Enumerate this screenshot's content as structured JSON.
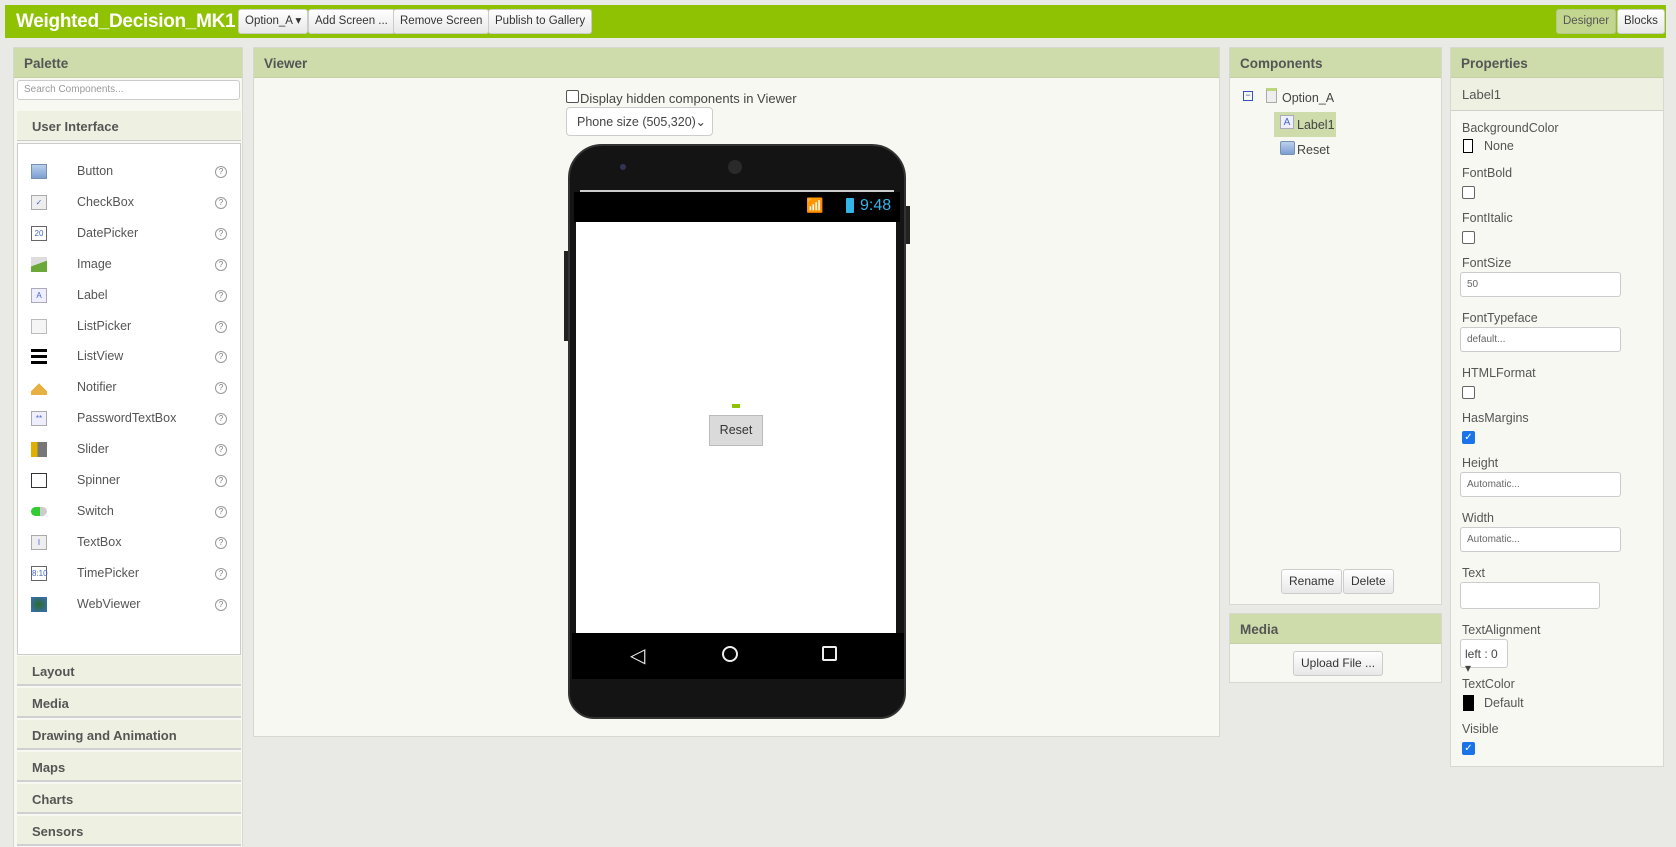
{
  "app": {
    "title": "Weighted_Decision_MK1",
    "screen_selector": "Option_A ▾",
    "add_screen": "Add Screen ...",
    "remove_screen": "Remove Screen",
    "publish": "Publish to Gallery",
    "designer": "Designer",
    "blocks": "Blocks",
    "accent": "#8fc202"
  },
  "palette": {
    "title": "Palette",
    "search_placeholder": "Search Components...",
    "open_category": "User Interface",
    "items": [
      {
        "label": "Button",
        "icon": "button-icon"
      },
      {
        "label": "CheckBox",
        "icon": "checkbox-icon"
      },
      {
        "label": "DatePicker",
        "icon": "datepicker-icon"
      },
      {
        "label": "Image",
        "icon": "image-icon"
      },
      {
        "label": "Label",
        "icon": "label-icon"
      },
      {
        "label": "ListPicker",
        "icon": "listpicker-icon"
      },
      {
        "label": "ListView",
        "icon": "listview-icon"
      },
      {
        "label": "Notifier",
        "icon": "notifier-icon"
      },
      {
        "label": "PasswordTextBox",
        "icon": "password-icon"
      },
      {
        "label": "Slider",
        "icon": "slider-icon"
      },
      {
        "label": "Spinner",
        "icon": "spinner-icon"
      },
      {
        "label": "Switch",
        "icon": "switch-icon"
      },
      {
        "label": "TextBox",
        "icon": "textbox-icon"
      },
      {
        "label": "TimePicker",
        "icon": "timepicker-icon"
      },
      {
        "label": "WebViewer",
        "icon": "webviewer-icon"
      }
    ],
    "help": "?",
    "categories": [
      "Layout",
      "Media",
      "Drawing and Animation",
      "Maps",
      "Charts",
      "Sensors"
    ]
  },
  "viewer": {
    "title": "Viewer",
    "hidden_label": "Display hidden components in Viewer",
    "size_select": "Phone size (505,320)",
    "clock": "9:48",
    "reset_button": "Reset"
  },
  "components": {
    "title": "Components",
    "tree": [
      {
        "label": "Option_A"
      },
      {
        "label": "Label1",
        "selected": true
      },
      {
        "label": "Reset"
      }
    ],
    "rename": "Rename",
    "delete": "Delete"
  },
  "media": {
    "title": "Media",
    "upload": "Upload File ..."
  },
  "properties": {
    "title": "Properties",
    "component": "Label1",
    "BackgroundColor": {
      "label": "BackgroundColor",
      "value": "None"
    },
    "FontBold": {
      "label": "FontBold",
      "checked": false
    },
    "FontItalic": {
      "label": "FontItalic",
      "checked": false
    },
    "FontSize": {
      "label": "FontSize",
      "value": "50"
    },
    "FontTypeface": {
      "label": "FontTypeface",
      "value": "default..."
    },
    "HTMLFormat": {
      "label": "HTMLFormat",
      "checked": false
    },
    "HasMargins": {
      "label": "HasMargins",
      "checked": true
    },
    "Height": {
      "label": "Height",
      "value": "Automatic..."
    },
    "Width": {
      "label": "Width",
      "value": "Automatic..."
    },
    "Text": {
      "label": "Text",
      "value": ""
    },
    "TextAlignment": {
      "label": "TextAlignment",
      "value": "left : 0 ▾"
    },
    "TextColor": {
      "label": "TextColor",
      "value": "Default"
    },
    "Visible": {
      "label": "Visible",
      "checked": true
    }
  }
}
